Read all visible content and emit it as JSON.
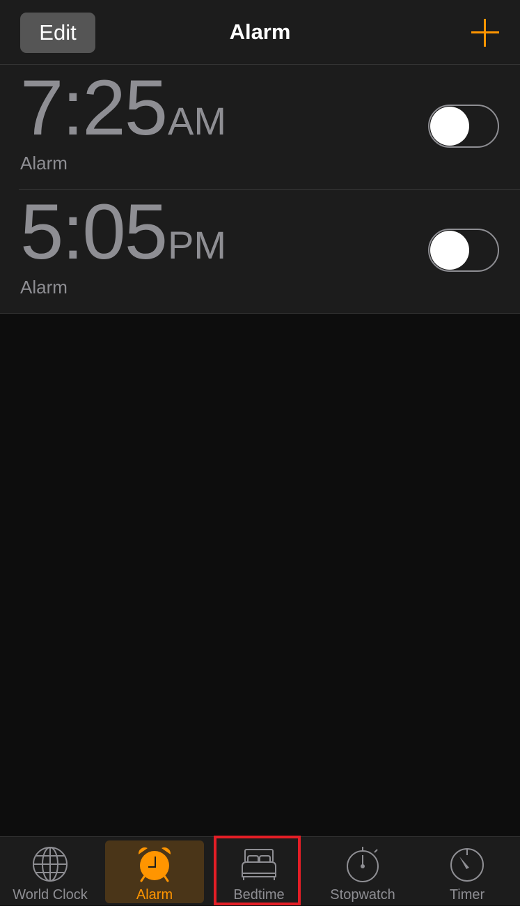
{
  "nav": {
    "edit_label": "Edit",
    "title": "Alarm"
  },
  "alarms": [
    {
      "time": "7:25",
      "period": "AM",
      "label": "Alarm",
      "enabled": false
    },
    {
      "time": "5:05",
      "period": "PM",
      "label": "Alarm",
      "enabled": false
    }
  ],
  "tabs": [
    {
      "label": "World Clock",
      "icon": "globe-icon",
      "active": false
    },
    {
      "label": "Alarm",
      "icon": "alarm-clock-icon",
      "active": true
    },
    {
      "label": "Bedtime",
      "icon": "bed-icon",
      "active": false
    },
    {
      "label": "Stopwatch",
      "icon": "stopwatch-icon",
      "active": false
    },
    {
      "label": "Timer",
      "icon": "timer-icon",
      "active": false
    }
  ],
  "colors": {
    "accent": "#ff9500",
    "highlight": "#e41e26",
    "secondary_text": "#8e8e93"
  }
}
